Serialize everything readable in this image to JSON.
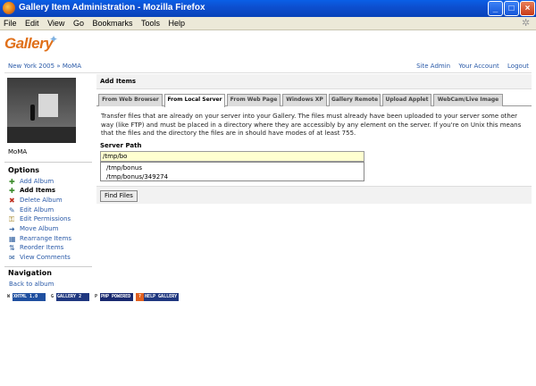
{
  "window": {
    "title": "Gallery Item Administration - Mozilla Firefox"
  },
  "menu": [
    "File",
    "Edit",
    "View",
    "Go",
    "Bookmarks",
    "Tools",
    "Help"
  ],
  "logo": {
    "text": "Gallery"
  },
  "breadcrumb": {
    "album": "New York 2005",
    "sep": "»",
    "item": "MoMA"
  },
  "system_links": [
    "Site Admin",
    "Your Account",
    "Logout"
  ],
  "album": {
    "name": "MoMA"
  },
  "options": {
    "heading": "Options",
    "items": [
      {
        "label": "Add Album",
        "icon": "add-album-icon"
      },
      {
        "label": "Add Items",
        "icon": "add-items-icon"
      },
      {
        "label": "Delete Album",
        "icon": "delete-icon"
      },
      {
        "label": "Edit Album",
        "icon": "edit-icon"
      },
      {
        "label": "Edit Permissions",
        "icon": "permissions-icon"
      },
      {
        "label": "Move Album",
        "icon": "move-icon"
      },
      {
        "label": "Rearrange Items",
        "icon": "rearrange-icon"
      },
      {
        "label": "Reorder Items",
        "icon": "reorder-icon"
      },
      {
        "label": "View Comments",
        "icon": "comments-icon"
      }
    ]
  },
  "navigation": {
    "heading": "Navigation",
    "back": "Back to album"
  },
  "badges": [
    "XHTML 1.0",
    "GALLERY 2",
    "PHP POWERED",
    "HELP GALLERY"
  ],
  "main": {
    "heading": "Add Items",
    "tabs": [
      "From Web Browser",
      "From Local Server",
      "From Web Page",
      "Windows XP",
      "Gallery Remote",
      "Upload Applet",
      "WebCam/Live Image"
    ],
    "active_tab": "From Local Server",
    "description": "Transfer files that are already on your server into your Gallery. The files must already have been uploaded to your server some other way (like FTP) and must be placed in a directory where they are accessibly by any element on the server. If you're on Unix this means that the files and the directory the files are in should have modes of at least 755.",
    "field_label": "Server Path",
    "input_value": "/tmp/bo",
    "suggestions": [
      "/tmp/bonus",
      "/tmp/bonus/349274"
    ],
    "find_button": "Find Files"
  },
  "colors": {
    "title_bar": "#0d4fd0",
    "link": "#2a5aa8",
    "input_bg": "#ffffd0",
    "logo": "#e0701a"
  }
}
